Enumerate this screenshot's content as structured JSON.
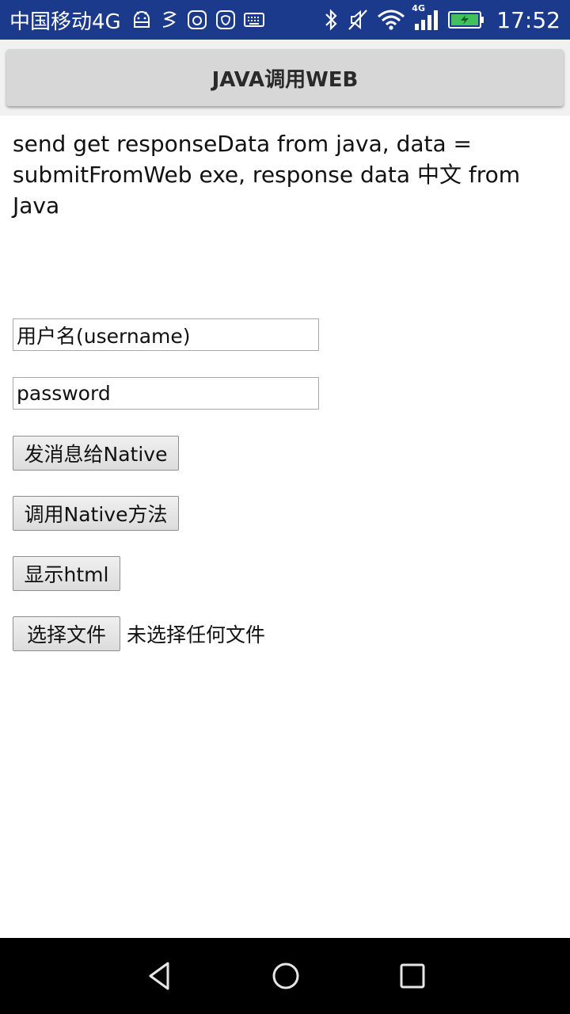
{
  "status_bar": {
    "carrier": "中国移动4G",
    "time": "17:52",
    "network_badge": "4G",
    "icons": [
      "android-icon",
      "notification-icon",
      "app-icon",
      "app-icon",
      "keyboard-icon",
      "bluetooth-icon",
      "mute-icon",
      "wifi-icon",
      "signal-icon",
      "battery-icon"
    ],
    "bg_color": "#1c3a8c"
  },
  "action_bar": {
    "button_label": "JAVA调用WEB"
  },
  "web": {
    "message": "send get responseData from java, data = submitFromWeb exe, response data 中文 from Java",
    "username_value": "用户名(username)",
    "password_value": "password",
    "send_button": "发消息给Native",
    "call_button": "调用Native方法",
    "show_button": "显示html",
    "file_button": "选择文件",
    "file_status": "未选择任何文件"
  },
  "nav_bar": {
    "icons": [
      "back-icon",
      "home-icon",
      "recent-apps-icon"
    ]
  }
}
